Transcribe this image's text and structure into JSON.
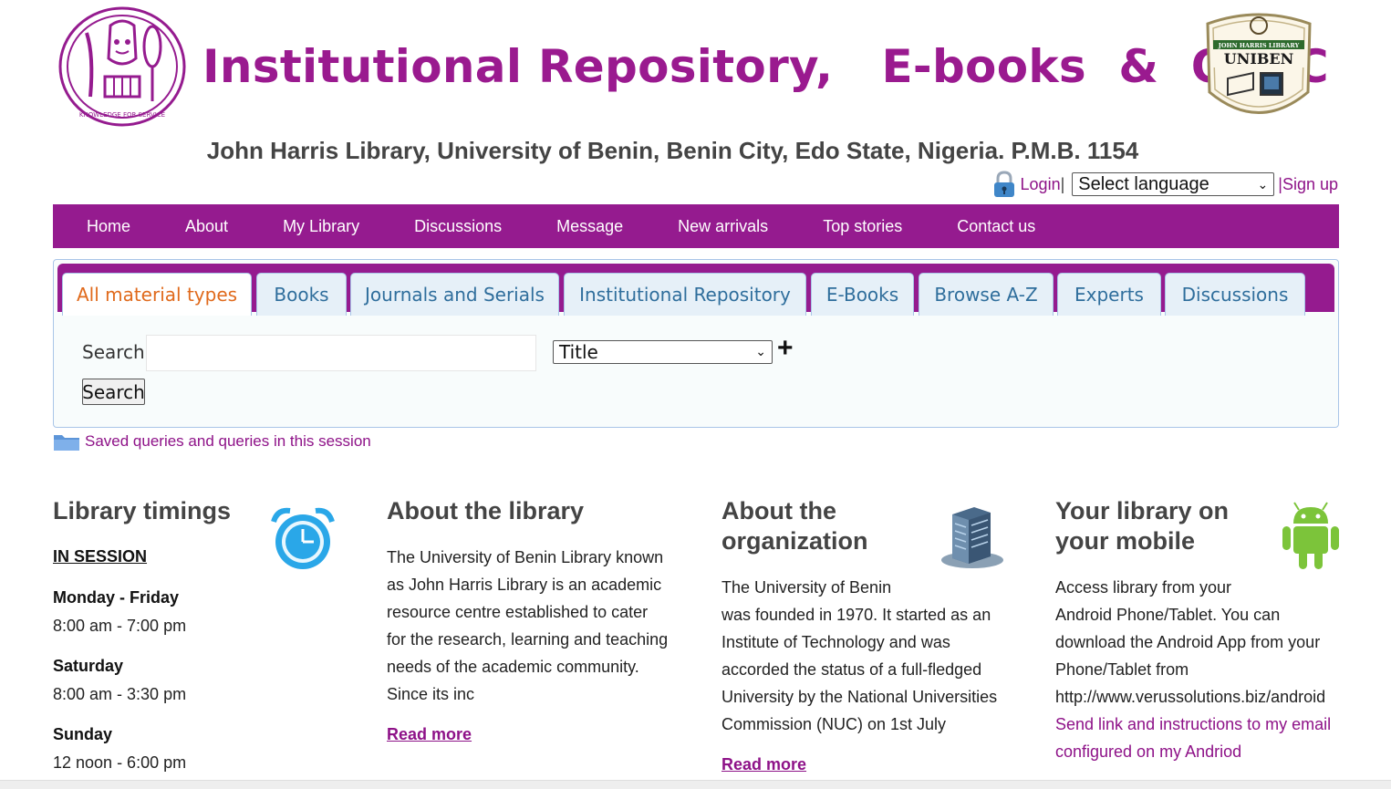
{
  "header": {
    "banner_title": "Institutional Repository,   E-books  &  OPAC",
    "subtitle": "John Harris Library, University of Benin, Benin City, Edo State, Nigeria. P.M.B. 1154",
    "right_logo_top": "JOHN HARRIS LIBRARY",
    "right_logo_name": "UNIBEN",
    "left_logo_motto": "KNOWLEDGE FOR SERVICE"
  },
  "userbar": {
    "login": "Login",
    "separator": " |",
    "language_selected": "Select language",
    "signup": "|Sign up"
  },
  "nav": {
    "items": [
      "Home",
      "About",
      "My Library",
      "Discussions",
      "Message",
      "New arrivals",
      "Top stories",
      "Contact us"
    ]
  },
  "tabs": [
    "All material types",
    "Books",
    "Journals and Serials",
    "Institutional Repository",
    "E-Books",
    "Browse A-Z",
    "Experts",
    "Discussions"
  ],
  "search": {
    "label": "Search",
    "input_value": "",
    "field_selected": "Title",
    "add_symbol": "+",
    "button_label": "Search"
  },
  "saved_queries": "Saved queries and queries in this session",
  "timings": {
    "title": "Library timings",
    "session": "IN SESSION",
    "slots": [
      {
        "day": "Monday - Friday",
        "hours": "8:00 am - 7:00 pm"
      },
      {
        "day": "Saturday",
        "hours": "8:00 am - 3:30 pm"
      },
      {
        "day": "Sunday",
        "hours": "12 noon - 6:00 pm"
      }
    ]
  },
  "about_library": {
    "title": "About the library",
    "lines": [
      "The University of Benin Library known",
      "as John Harris Library is an academic",
      "resource centre established to cater",
      "for the research, learning and teaching",
      "needs of the academic community.",
      "Since its inc"
    ],
    "read_more": "Read more"
  },
  "about_org": {
    "title_line1": "About the",
    "title_line2": "organization",
    "lines": [
      "The University of Benin",
      "was founded in 1970. It started as an",
      "Institute of Technology and was",
      "accorded the status of a full-fledged",
      "University by the National Universities",
      "Commission (NUC) on 1st July"
    ],
    "read_more": "Read more"
  },
  "mobile": {
    "title_line1": "Your library on",
    "title_line2": "your mobile",
    "lines": [
      "Access library from your",
      "Android Phone/Tablet. You can",
      "download the Android App from your",
      "Phone/Tablet from",
      "http://www.verussolutions.biz/android"
    ],
    "link_lines": [
      "Send link and instructions to my email",
      "configured on my Andriod"
    ]
  },
  "colors": {
    "brand": "#951b8f",
    "link": "#8e1288",
    "tab_text": "#2f6e9c",
    "active_tab_text": "#e06a1c"
  }
}
